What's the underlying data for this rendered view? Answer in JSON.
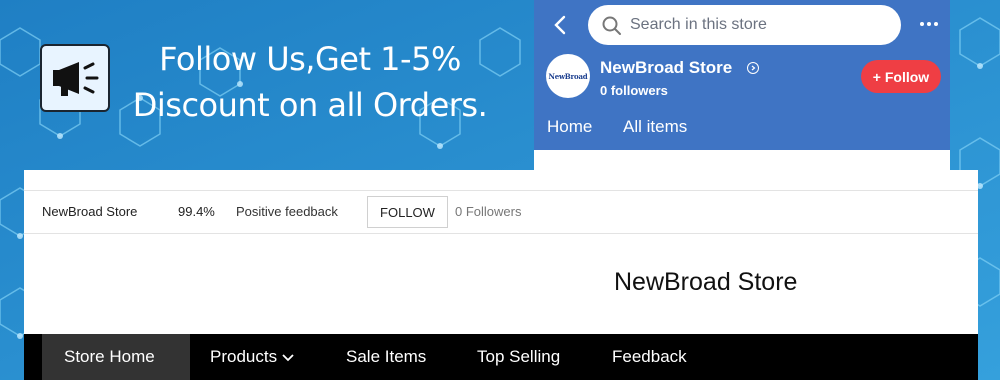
{
  "banner": {
    "promo_line1": "Follow Us,Get 1-5%",
    "promo_line2": "Discount on all Orders.",
    "megaphone_icon": "megaphone-icon"
  },
  "mobile": {
    "search_placeholder": "Search in this store",
    "logo_text": "NewBroad",
    "store_name": "NewBroad Store",
    "followers": "0 followers",
    "follow_button": "+ Follow",
    "tabs": [
      {
        "label": "Home"
      },
      {
        "label": "All items"
      }
    ],
    "colors": {
      "card": "#3f74c4",
      "follow": "#ef3e44"
    }
  },
  "infobar": {
    "store_name": "NewBroad Store",
    "feedback_pct": "99.4%",
    "feedback_label": "Positive feedback",
    "follow_button": "FOLLOW",
    "followers": "0 Followers"
  },
  "store_title": "NewBroad Store",
  "nav": {
    "items": [
      {
        "label": "Store Home",
        "active": true
      },
      {
        "label": "Products",
        "has_dropdown": true
      },
      {
        "label": "Sale Items"
      },
      {
        "label": "Top Selling"
      },
      {
        "label": "Feedback"
      }
    ]
  },
  "colors": {
    "page_bg": "#2a8fd0",
    "nav_bg": "#000000",
    "nav_active": "#333333"
  }
}
